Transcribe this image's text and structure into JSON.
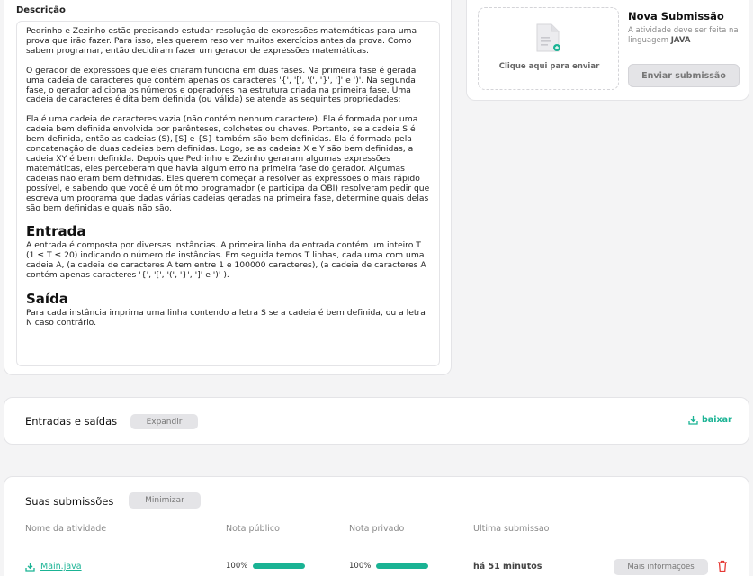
{
  "description": {
    "title": "Descrição",
    "paragraphs": [
      "Pedrinho e Zezinho estão precisando estudar resolução de expressões matemáticas para uma prova que irão fazer. Para isso, eles querem resolver muitos exercícios antes da prova. Como sabem programar, então decidiram fazer um gerador de expressões matemáticas.",
      "O gerador de expressões que eles criaram funciona em duas fases. Na primeira fase é gerada uma cadeia de caracteres que contém apenas os caracteres '{', '[', '(', '}', ']' e ')'. Na segunda fase, o gerador adiciona os números e operadores na estrutura criada na primeira fase. Uma cadeia de caracteres é dita bem definida (ou válida) se atende as seguintes propriedades:",
      "Ela é uma cadeia de caracteres vazia (não contém nenhum caractere). Ela é formada por uma cadeia bem definida envolvida por parênteses, colchetes ou chaves. Portanto, se a cadeia S é bem definida, então as cadeias (S), [S] e {S} também são bem definidas. Ela é formada pela concatenação de duas cadeias bem definidas. Logo, se as cadeias X e Y são bem definidas, a cadeia XY é bem definida. Depois que Pedrinho e Zezinho geraram algumas expressões matemáticas, eles perceberam que havia algum erro na primeira fase do gerador. Algumas cadeias não eram bem definidas. Eles querem começar a resolver as expressões o mais rápido possível, e sabendo que você é um ótimo programador (e participa da OBI) resolveram pedir que escreva um programa que dadas várias cadeias geradas na primeira fase, determine quais delas são bem definidas e quais não são."
    ],
    "input_heading": "Entrada",
    "input_text": "A entrada é composta por diversas instâncias. A primeira linha da entrada contém um inteiro T (1 ≤ T ≤ 20) indicando o número de instâncias. Em seguida temos T linhas, cada uma com uma cadeia A, (a cadeia de caracteres A tem entre 1 e 100000 caracteres), (a cadeia de caracteres A contém apenas caracteres '{', '[', '(', '}', ']' e ')' ).",
    "output_heading": "Saída",
    "output_text": "Para cada instância imprima uma linha contendo a letra S se a cadeia é bem definida, ou a letra N caso contrário."
  },
  "submission": {
    "upload_text": "Clique aqui para enviar",
    "title": "Nova Submissão",
    "note_prefix": "A atividade deve ser feita na linguagem",
    "language": "JAVA",
    "send_label": "Enviar submissão"
  },
  "io": {
    "title": "Entradas e saídas",
    "expand_label": "Expandir",
    "download_label": "baixar"
  },
  "submissions": {
    "title": "Suas submissões",
    "minimize_label": "Minimizar",
    "columns": [
      "Nome da atividade",
      "Nota público",
      "Nota privado",
      "Ultima submissao"
    ],
    "rows": [
      {
        "file": "Main.java",
        "public_score": "100%",
        "public_fraction": 1.0,
        "private_score": "100%",
        "private_fraction": 1.0,
        "last": "há 51 minutos",
        "more_label": "Mais informações"
      }
    ]
  },
  "colors": {
    "accent": "#1ab394",
    "delete": "#e53935"
  },
  "icons": [
    "file-add-icon",
    "download-icon",
    "trash-icon"
  ]
}
